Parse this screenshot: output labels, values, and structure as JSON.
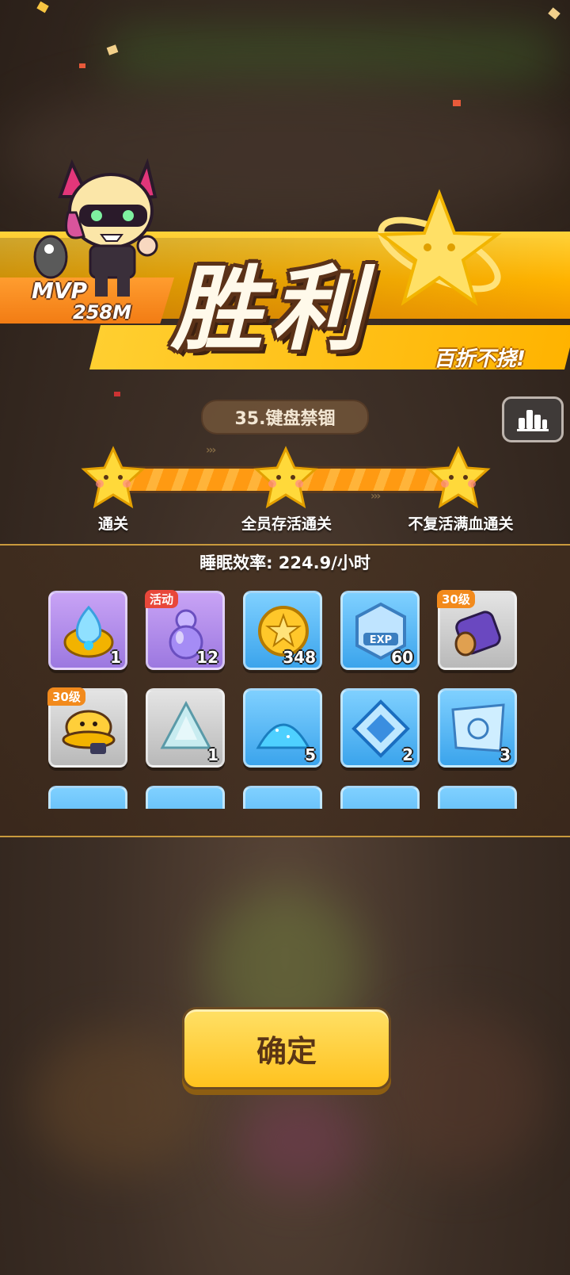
{
  "banner": {
    "title": "胜利",
    "subtitle": "百折不挠!",
    "mvp_label": "MVP",
    "mvp_value": "258M"
  },
  "stage": {
    "name": "35.键盘禁锢"
  },
  "progress": {
    "milestones": [
      "通关",
      "全员存活通关",
      "不复活满血通关"
    ],
    "stars_earned": 3
  },
  "rewards": {
    "sleep_rate": "睡眠效率: 224.9/小时",
    "items": [
      {
        "icon": "blue-flame-orb-icon",
        "color": "purple",
        "count": "1",
        "tag": ""
      },
      {
        "icon": "gourd-potion-icon",
        "color": "purple",
        "count": "12",
        "tag": "活动"
      },
      {
        "icon": "gold-coin-icon",
        "color": "blue",
        "count": "348",
        "tag": ""
      },
      {
        "icon": "exp-badge-icon",
        "color": "blue",
        "count": "60",
        "tag": ""
      },
      {
        "icon": "purple-barrel-icon",
        "color": "gray",
        "count": "",
        "tag": "30级"
      },
      {
        "icon": "duck-helmet-icon",
        "color": "gray",
        "count": "",
        "tag": "30级"
      },
      {
        "icon": "crystal-shard-icon",
        "color": "gray",
        "count": "1",
        "tag": ""
      },
      {
        "icon": "blue-powder-icon",
        "color": "blue",
        "count": "5",
        "tag": ""
      },
      {
        "icon": "ice-rune-icon",
        "color": "blue",
        "count": "2",
        "tag": ""
      },
      {
        "icon": "blueprint-map-icon",
        "color": "blue",
        "count": "3",
        "tag": ""
      }
    ]
  },
  "footer": {
    "confirm_label": "确定"
  },
  "colors": {
    "banner_yellow": "#ffb300",
    "panel_gold_line": "#c99a3d",
    "confirm_yellow": "#ffc21e"
  }
}
